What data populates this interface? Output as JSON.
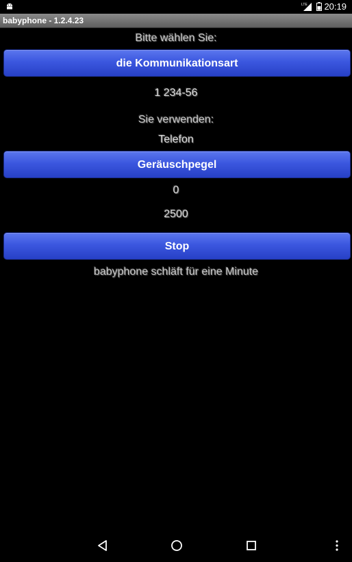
{
  "status_bar": {
    "time": "20:19",
    "network": "LTE",
    "icons": [
      "android-icon",
      "signal-icon",
      "battery-icon"
    ]
  },
  "app": {
    "title": "babyphone - 1.2.4.23"
  },
  "main": {
    "choose_label": "Bitte wählen Sie:",
    "communication_button": "die Kommunikationsart",
    "phone_number": "1 234-56",
    "using_label": "Sie verwenden:",
    "using_value": "Telefon",
    "noise_button": "Geräuschpegel",
    "noise_level": "0",
    "noise_threshold": "2500",
    "stop_button": "Stop",
    "status_message": "babyphone schläft für eine Minute"
  },
  "nav_bar": {
    "icons": [
      "back-icon",
      "home-icon",
      "recents-icon",
      "overflow-menu-icon"
    ]
  },
  "colors": {
    "background": "#000000",
    "button_blue": "#3b57df",
    "title_bar": "#707070",
    "label_text": "#c8c8c8"
  }
}
